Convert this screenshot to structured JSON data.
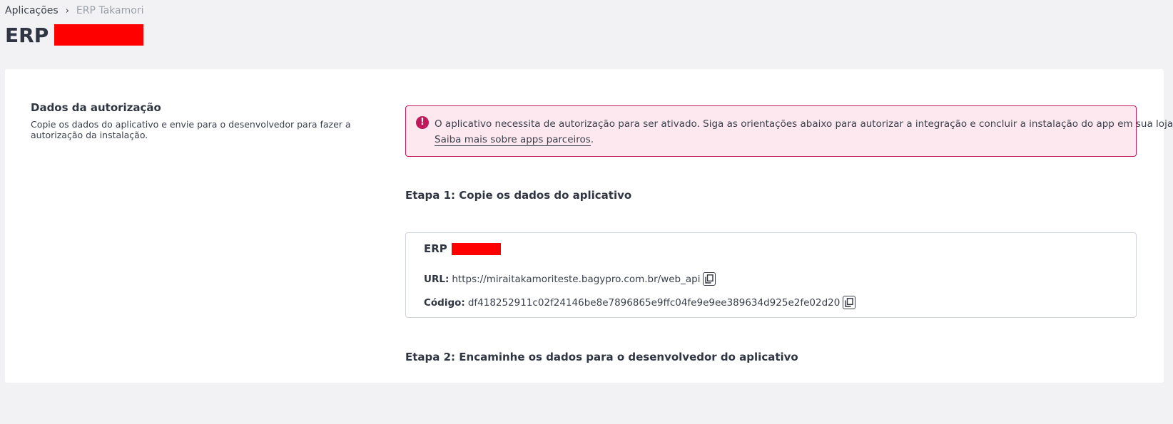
{
  "breadcrumb": {
    "parent": "Aplicações",
    "separator": "›",
    "current": "ERP Takamori"
  },
  "page": {
    "title_prefix": "ERP"
  },
  "left": {
    "title": "Dados da autorização",
    "description": "Copie os dados do aplicativo e envie para o desenvolvedor para fazer a autorização da instalação."
  },
  "alert": {
    "icon": "exclamation-circle-icon",
    "message": "O aplicativo necessita de autorização para ser ativado. Siga as orientações abaixo para autorizar a integração e concluir a instalação do app em sua loja.",
    "link_text": "Saiba mais sobre apps parceiros",
    "link_suffix": ".",
    "color": "#c2185b",
    "background": "#fce8ee"
  },
  "step1": {
    "title": "Etapa 1: Copie os dados do aplicativo"
  },
  "app_box": {
    "name_prefix": "ERP",
    "url_label": "URL:",
    "url_value": "https://miraitakamoriteste.bagypro.com.br/web_api",
    "code_label": "Código:",
    "code_value": "df418252911c02f24146be8e7896865e9ffc04fe9e9ee389634d925e2fe02d20",
    "copy_icon": "copy-icon"
  },
  "step2": {
    "title": "Etapa 2: Encaminhe os dados para o desenvolvedor do aplicativo"
  }
}
